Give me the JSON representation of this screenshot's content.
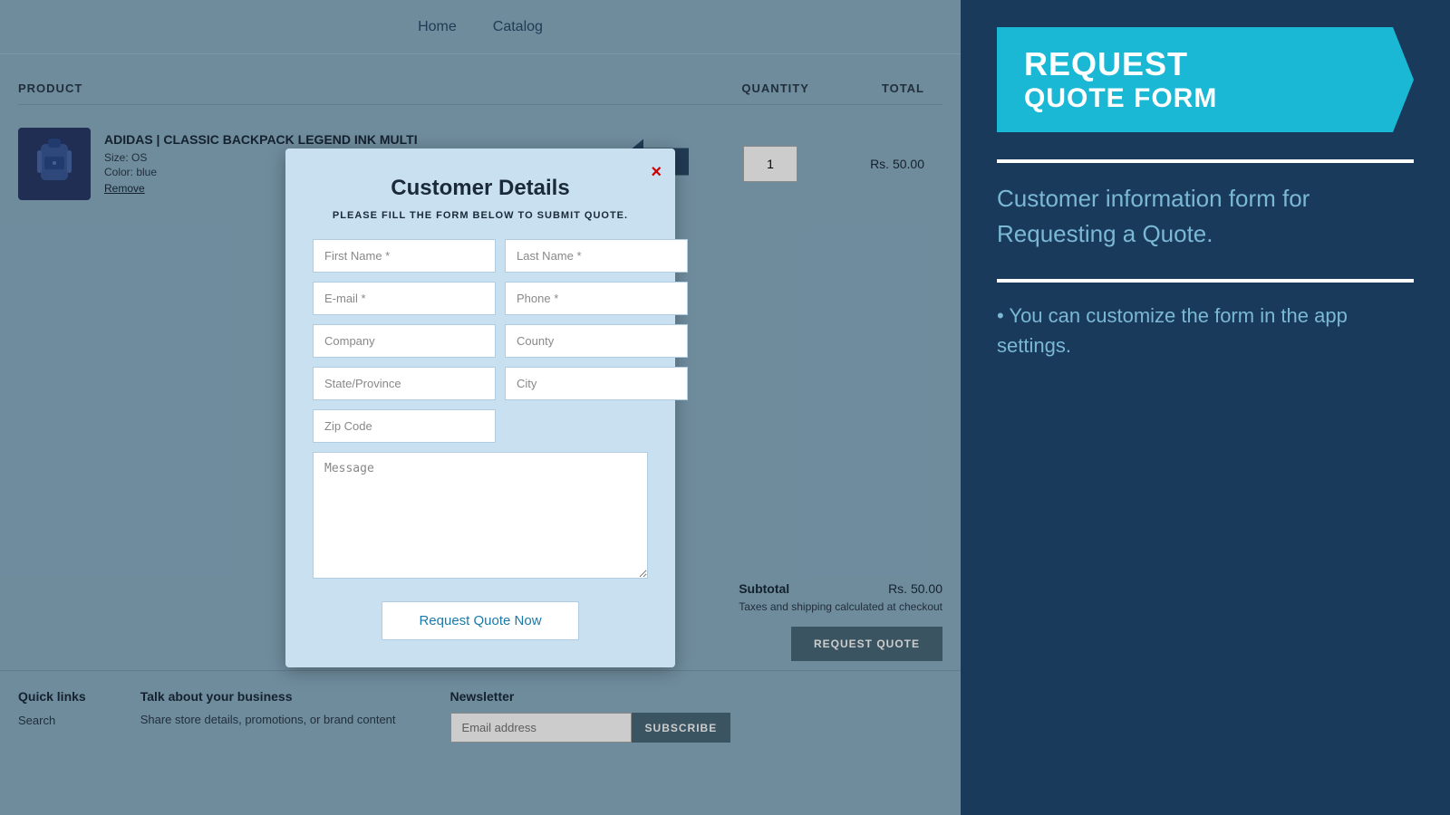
{
  "nav": {
    "links": [
      "Home",
      "Catalog"
    ]
  },
  "cart": {
    "headers": {
      "product": "PRODUCT",
      "quantity": "QUANTITY",
      "total": "TOTAL"
    },
    "product": {
      "name": "ADIDAS | CLASSIC BACKPACK LEGEND INK MULTI",
      "size": "Size: OS",
      "color": "Color: blue",
      "remove": "Remove",
      "quantity": "1",
      "total": "Rs. 50.00"
    },
    "subtotal": {
      "label": "Subtotal",
      "value": "Rs. 50.00",
      "tax_note": "Taxes and shipping calculated at checkout"
    },
    "request_quote_btn": "REQUEST QUOTE"
  },
  "footer": {
    "quick_links": {
      "title": "Quick links",
      "items": [
        "Search"
      ]
    },
    "business": {
      "title": "Talk about your business",
      "text": "Share store details, promotions, or brand content"
    },
    "newsletter": {
      "title": "Newsletter",
      "email_placeholder": "Email address",
      "subscribe_btn": "SUBSCRIBE"
    }
  },
  "modal": {
    "title": "Customer Details",
    "subtitle": "PLEASE FILL THE FORM BELOW TO SUBMIT QUOTE.",
    "close": "×",
    "fields": {
      "first_name": "First Name *",
      "last_name": "Last Name *",
      "email": "E-mail *",
      "phone": "Phone *",
      "company": "Company",
      "county": "County",
      "state_province": "State/Province",
      "city": "City",
      "zip_code": "Zip Code",
      "message": "Message"
    },
    "submit_btn": "Request Quote Now"
  },
  "sidebar": {
    "banner_line1": "REQUEST",
    "banner_line2": "QUOTE FORM",
    "description": "Customer information form for Requesting a Quote.",
    "tip": "• You can customize the form in the app settings."
  }
}
